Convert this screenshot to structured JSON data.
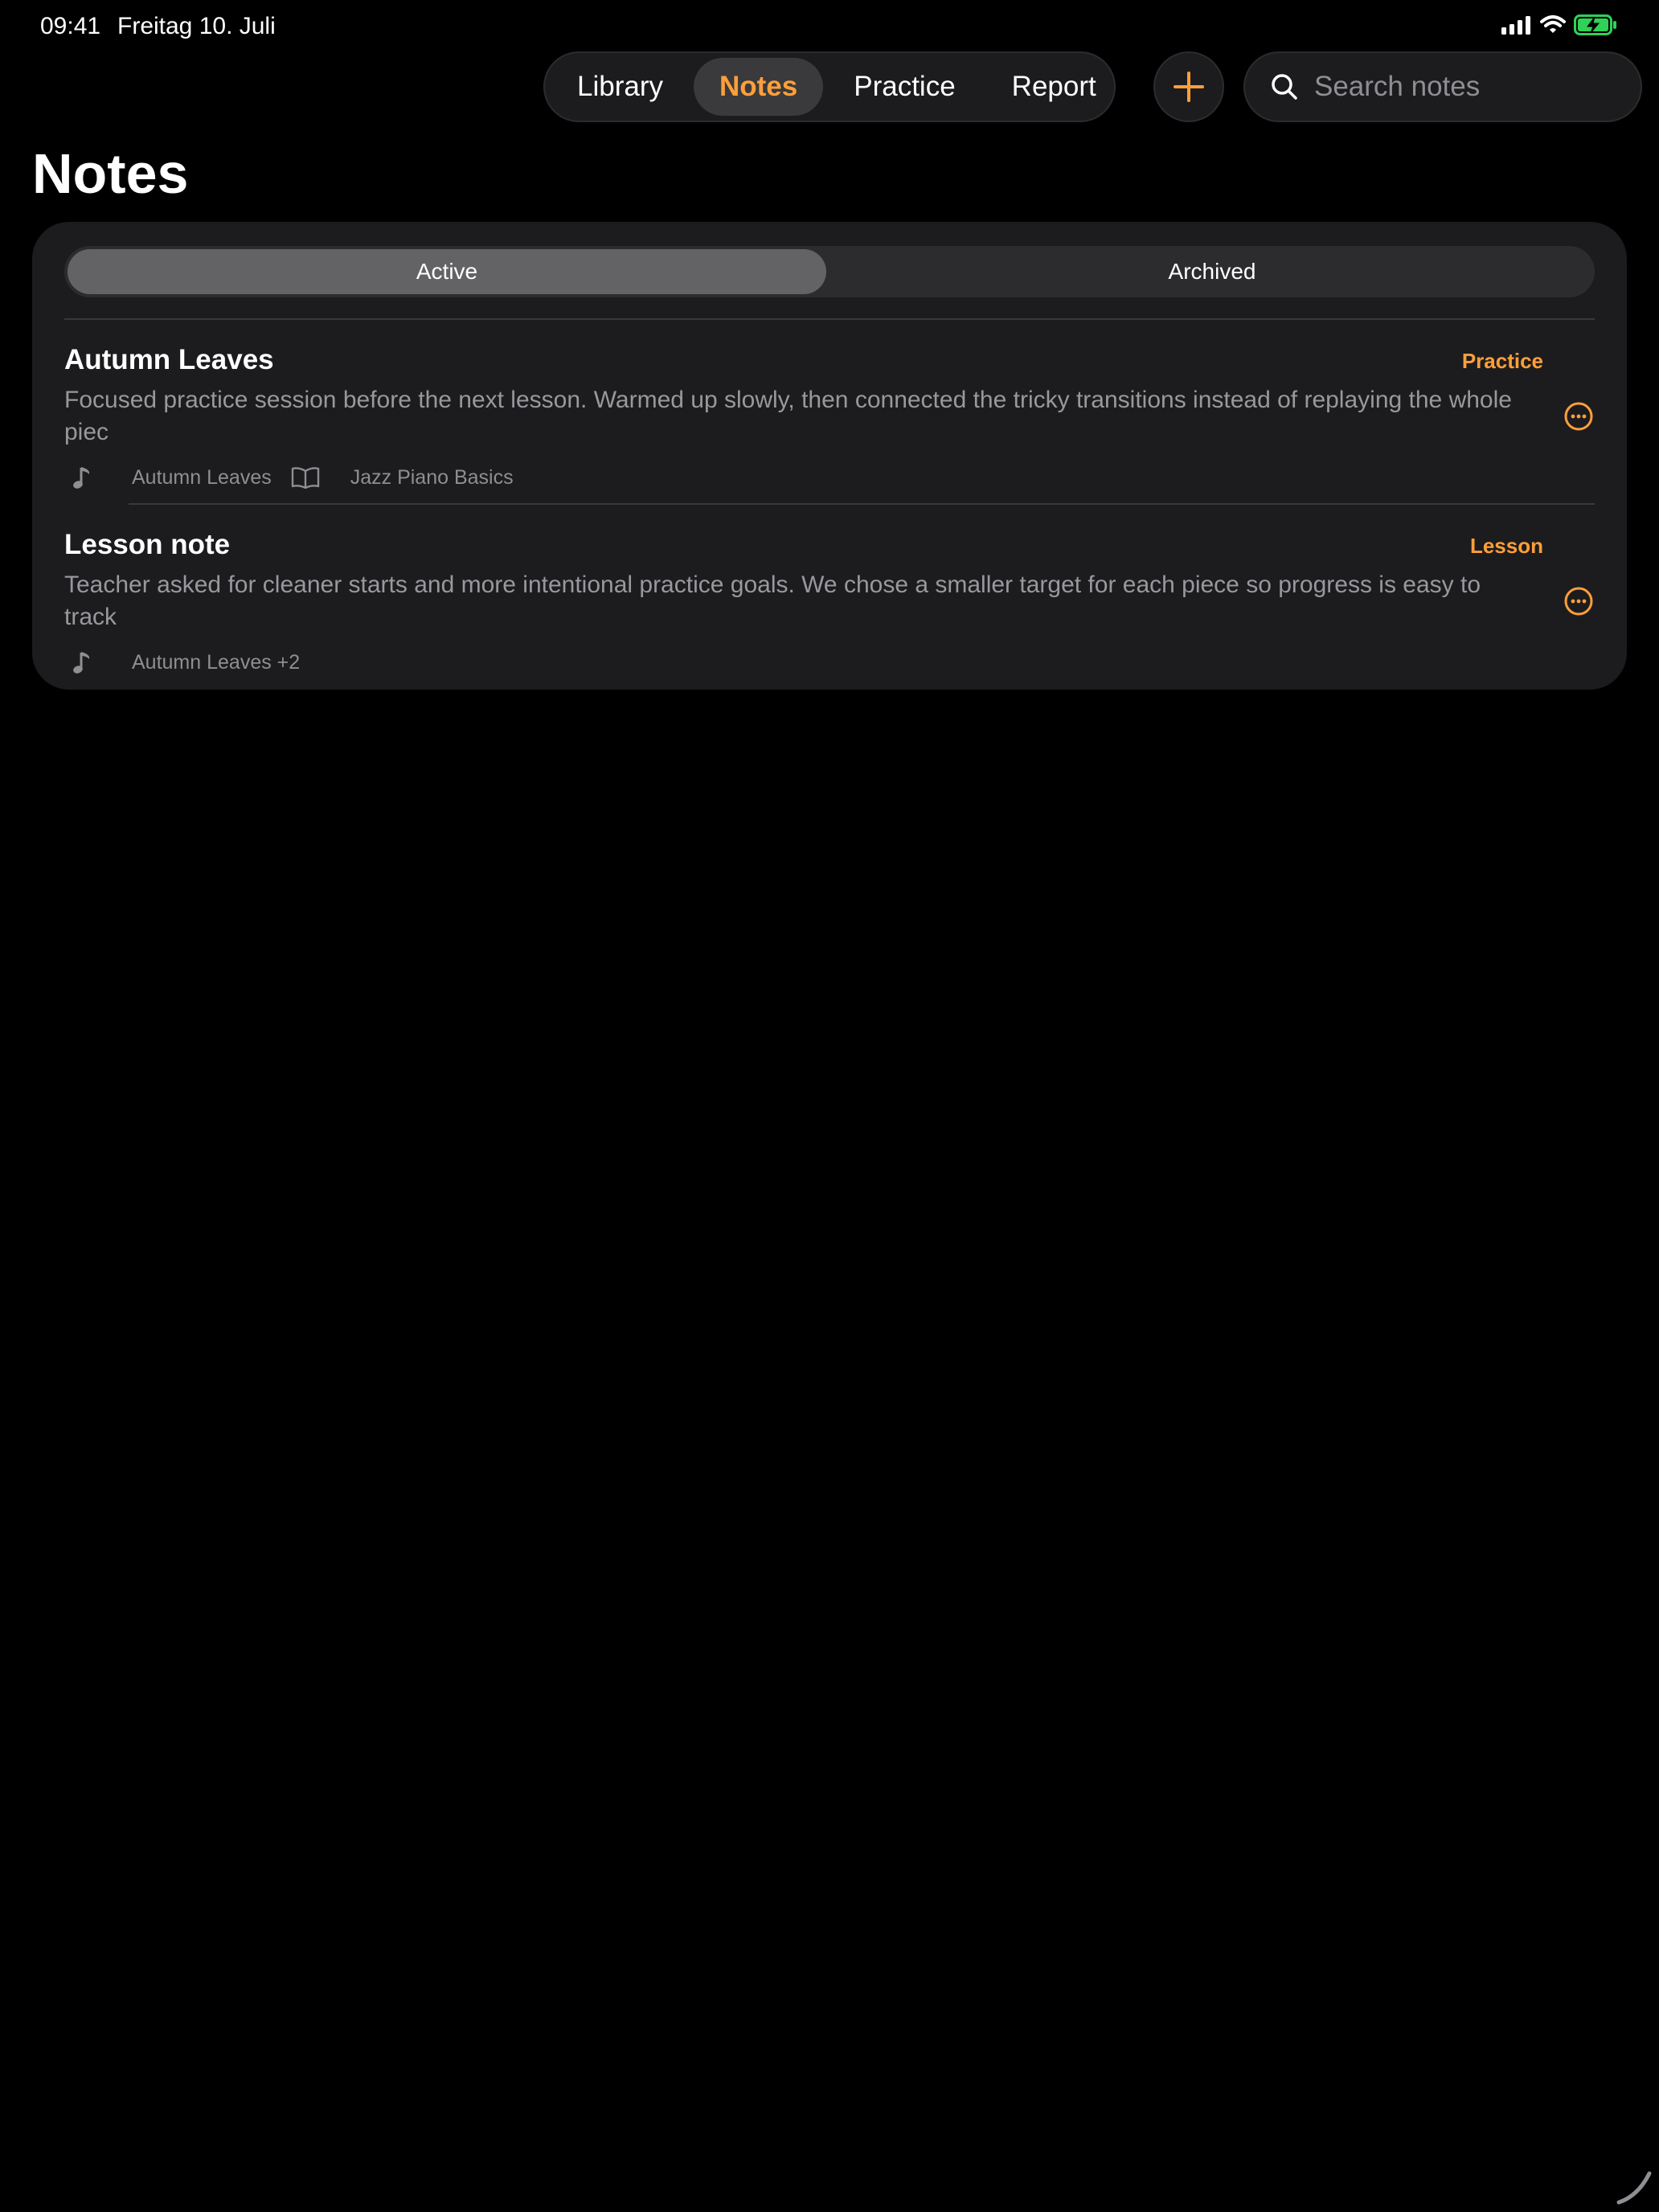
{
  "status_bar": {
    "time": "09:41",
    "date": "Freitag 10. Juli"
  },
  "nav": {
    "tabs": [
      {
        "label": "Library"
      },
      {
        "label": "Notes",
        "active": true
      },
      {
        "label": "Practice"
      },
      {
        "label": "Report"
      }
    ]
  },
  "search": {
    "placeholder": "Search notes"
  },
  "page": {
    "title": "Notes"
  },
  "segments": {
    "active": "Active",
    "archived": "Archived",
    "selected": "Active"
  },
  "notes": [
    {
      "title": "Autumn Leaves",
      "tag": "Practice",
      "body": "Focused practice session before the next lesson. Warmed up slowly, then connected the tricky transitions instead of replaying the whole piec",
      "piece": "Autumn Leaves",
      "book": "Jazz Piano Basics"
    },
    {
      "title": "Lesson note",
      "tag": "Lesson",
      "body": "Teacher asked for cleaner starts and more intentional practice goals. We chose a smaller target for each piece so progress is easy to track",
      "piece": "Autumn Leaves +2"
    }
  ],
  "colors": {
    "accent": "#ff9f3a",
    "background": "#000000",
    "card": "#1c1c1e",
    "battery": "#30d158"
  },
  "icons": {
    "add": "plus-icon",
    "search": "magnifier-icon",
    "more": "ellipsis-circle-icon",
    "piece": "music-note-icon",
    "book": "book-icon"
  }
}
